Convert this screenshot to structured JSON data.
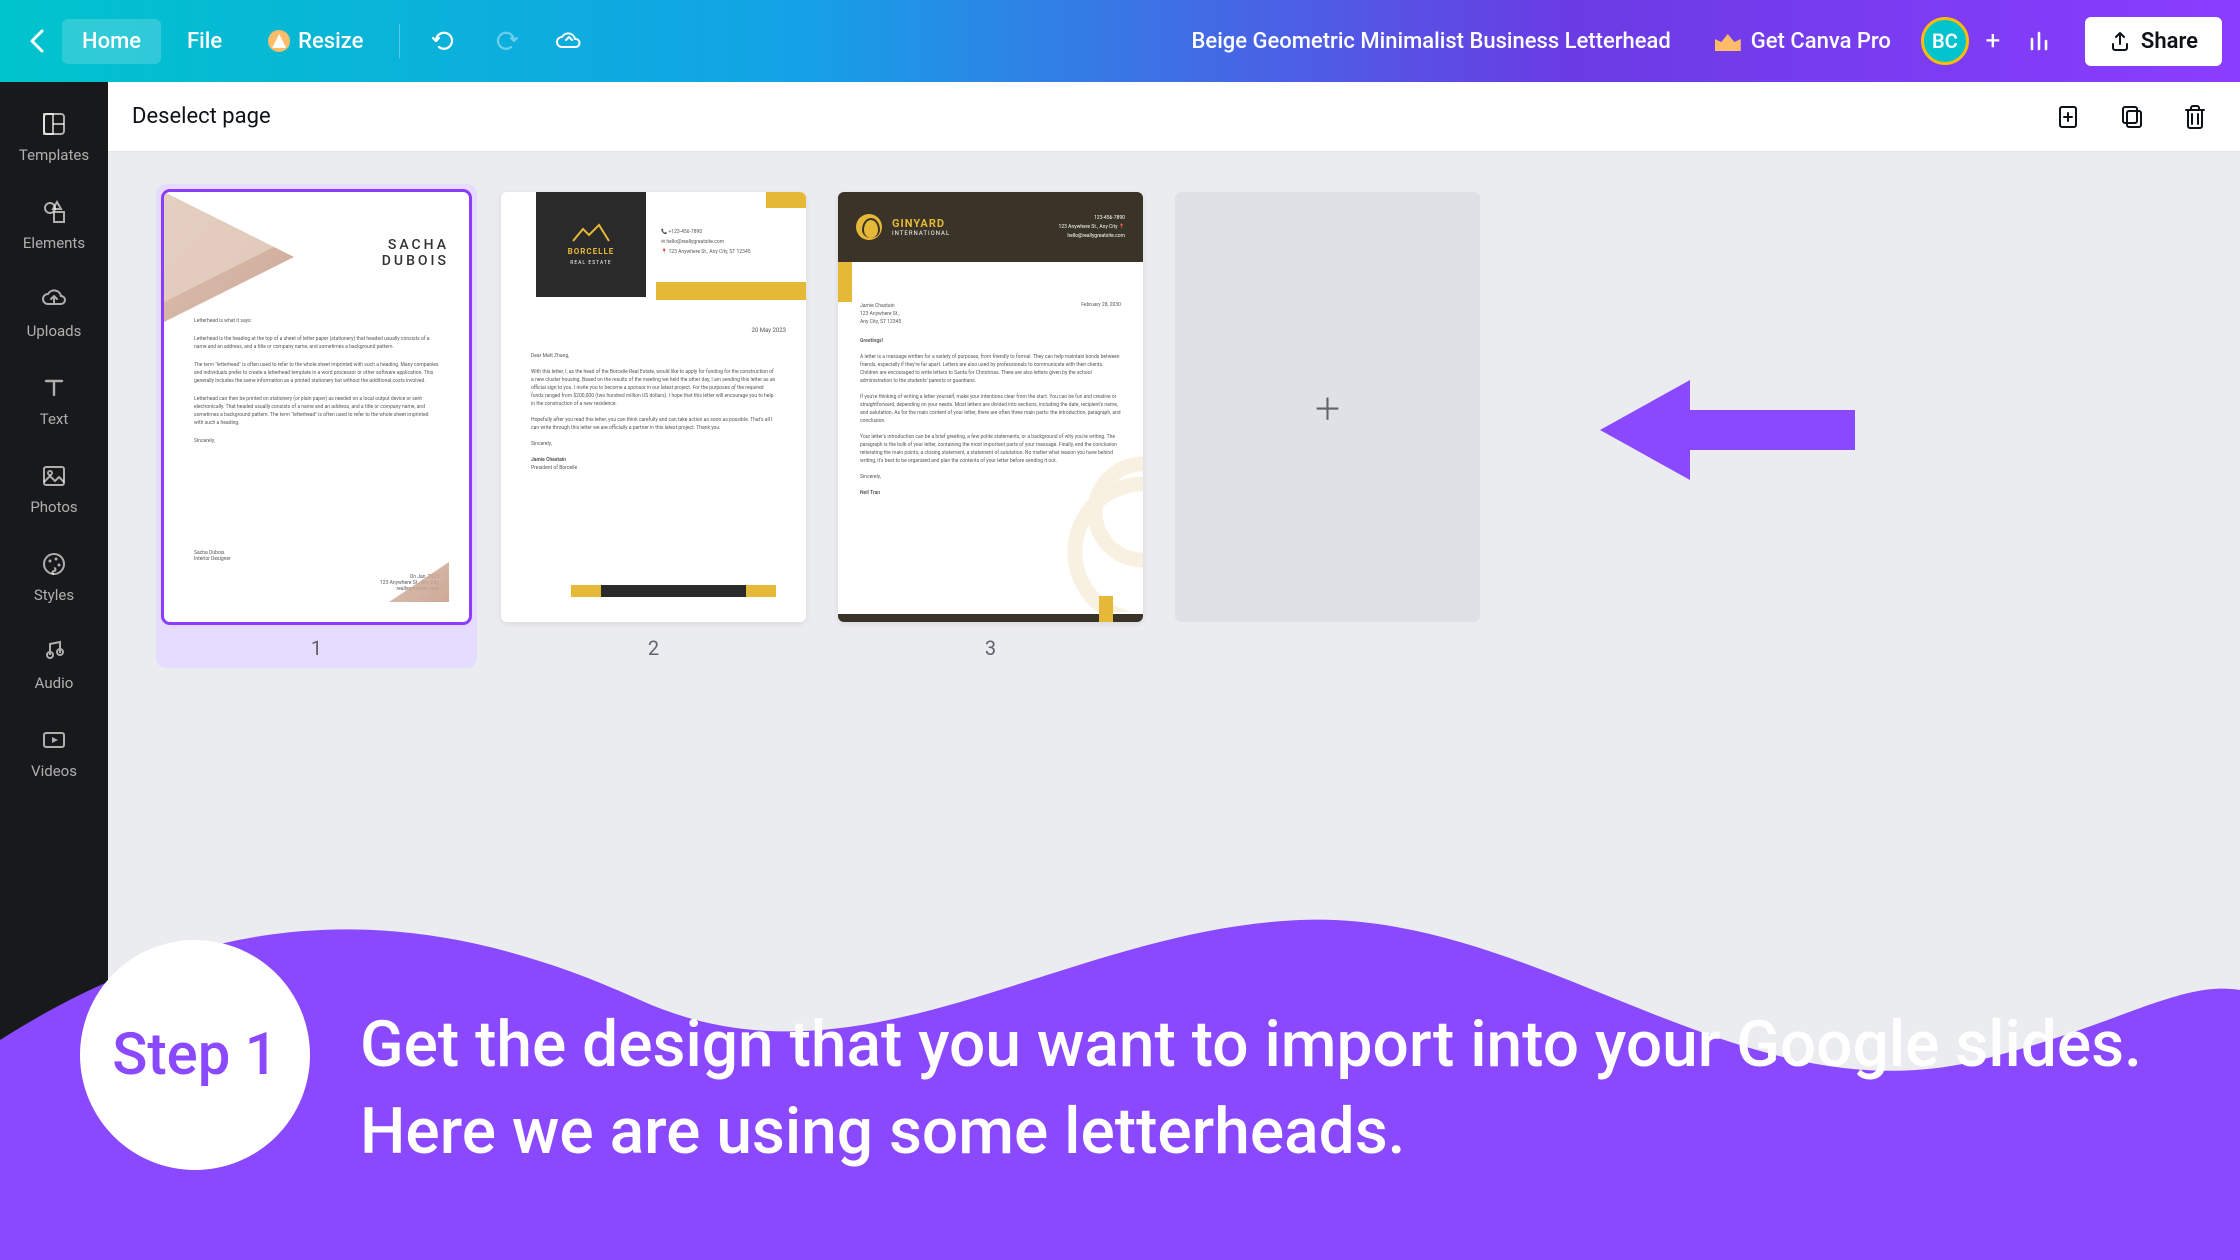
{
  "topbar": {
    "home": "Home",
    "file": "File",
    "resize": "Resize",
    "doc_title": "Beige Geometric Minimalist Business Letterhead",
    "get_pro": "Get Canva Pro",
    "avatar_initials": "BC",
    "share": "Share"
  },
  "sidebar": {
    "items": [
      {
        "label": "Templates"
      },
      {
        "label": "Elements"
      },
      {
        "label": "Uploads"
      },
      {
        "label": "Text"
      },
      {
        "label": "Photos"
      },
      {
        "label": "Styles"
      },
      {
        "label": "Audio"
      },
      {
        "label": "Videos"
      }
    ]
  },
  "subbar": {
    "deselect": "Deselect page"
  },
  "pages": {
    "p1_num": "1",
    "p2_num": "2",
    "p3_num": "3",
    "p1": {
      "name_first": "SACHA",
      "name_last": "DUBOIS"
    },
    "p2": {
      "brand": "BORCELLE",
      "brand_sub": "REAL ESTATE",
      "date": "20 May 2023",
      "greeting": "Dear Matt Zhang,",
      "signoff": "Sincerely,",
      "signer": "Jamie Chastain",
      "signer_title": "President of Borcelle"
    },
    "p3": {
      "brand": "GINYARD",
      "brand_sub": "INTERNATIONAL",
      "phone": "123-456-7890",
      "addr_short": "123 Anywhere St., Any City",
      "email": "hello@reallygreatsite.com",
      "addr_name": "Jamie Chastain",
      "addr_line1": "123 Anywhere St.,",
      "addr_line2": "Any City, ST 12345",
      "date": "February 28, 2030",
      "greeting": "Greetings!",
      "signoff": "Sincerely,",
      "signer": "Neil Tran"
    }
  },
  "annotation": {
    "step_label": "Step 1",
    "step_text": "Get the design that you want to import into your Google slides. Here we are using some letterheads."
  }
}
